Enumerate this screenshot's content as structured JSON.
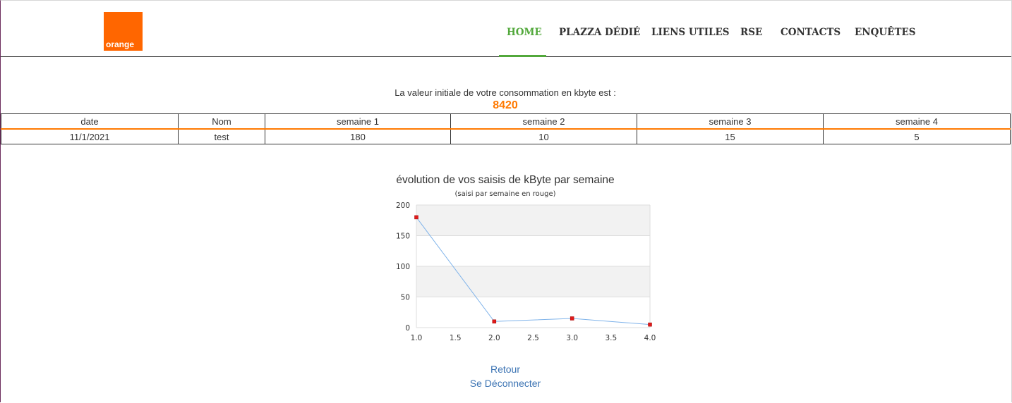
{
  "header": {
    "logo_text": "orange",
    "nav": [
      "HOME",
      "PLAZZA DÉDIÉ",
      "LIENS UTILES",
      "RSE",
      "CONTACTS",
      "ENQUÊTES"
    ],
    "active_nav": "HOME"
  },
  "intro": {
    "text": "La valeur initiale de votre consommation en kbyte est :",
    "value": "8420"
  },
  "table": {
    "headers": [
      "date",
      "Nom",
      "semaine 1",
      "semaine 2",
      "semaine 3",
      "semaine 4"
    ],
    "rows": [
      [
        "11/1/2021",
        "test",
        "180",
        "10",
        "15",
        "5"
      ]
    ]
  },
  "chart_data": {
    "type": "line",
    "title": "évolution de vos saisis de kByte par semaine",
    "subtitle": "(saisi par semaine en rouge)",
    "x": [
      1,
      2,
      3,
      4
    ],
    "values": [
      180,
      10,
      15,
      5
    ],
    "xlim": [
      1,
      4
    ],
    "ylim": [
      0,
      200
    ],
    "xticks": [
      "1.0",
      "1.5",
      "2.0",
      "2.5",
      "3.0",
      "3.5",
      "4.0"
    ],
    "yticks": [
      "0",
      "50",
      "100",
      "150",
      "200"
    ],
    "line_color": "#7fb3ea",
    "point_color": "#e01b1b",
    "band_color": "#f2f2f2",
    "grid": true
  },
  "links": {
    "back": "Retour",
    "logout": "Se Déconnecter"
  },
  "colors": {
    "brand": "#ff6600",
    "accent": "#ff7900",
    "nav_active": "#52a83b",
    "link": "#3b73b3"
  }
}
